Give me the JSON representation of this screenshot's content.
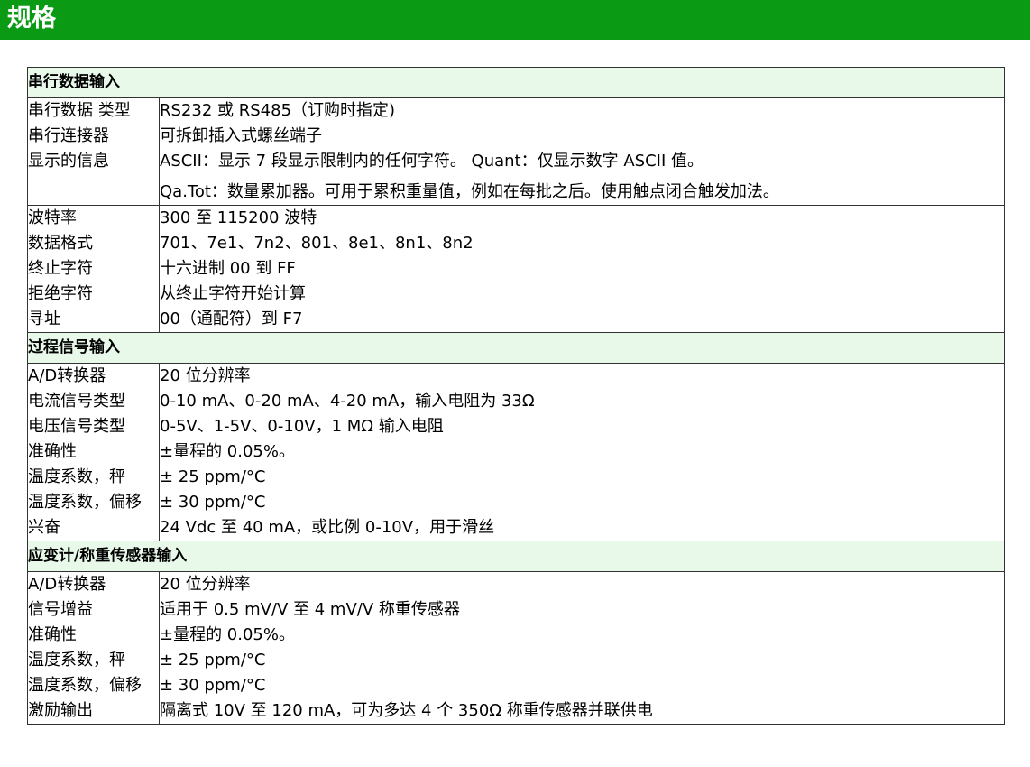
{
  "header": {
    "title": "规格"
  },
  "sections": [
    {
      "title": "串行数据输入",
      "groups": [
        {
          "labels": [
            "串行数据 类型",
            "串行连接器",
            "显示的信息"
          ],
          "values": [
            "RS232 或 RS485（订购时指定)",
            "可拆卸插入式螺丝端子",
            "ASCII：显示 7 段显示限制内的任何字符。 Quant：仅显示数字 ASCII 值。",
            "Qa.Tot：数量累加器。可用于累积重量值，例如在每批之后。使用触点闭合触发加法。"
          ]
        },
        {
          "labels": [
            "波特率",
            "数据格式",
            "终止字符",
            "拒绝字符",
            "寻址"
          ],
          "values": [
            "300 至 115200 波特",
            "701、7e1、7n2、801、8e1、8n1、8n2",
            "十六进制 00 到 FF",
            "从终止字符开始计算",
            "00（通配符）到 F7"
          ]
        }
      ]
    },
    {
      "title": "过程信号输入",
      "groups": [
        {
          "labels": [
            "A/D转换器",
            "电流信号类型",
            "电压信号类型",
            "准确性",
            "温度系数，秤",
            "温度系数，偏移",
            "兴奋"
          ],
          "values": [
            "20 位分辨率",
            "0-10 mA、0-20 mA、4-20 mA，输入电阻为 33Ω",
            "0-5V、1-5V、0-10V，1 MΩ 输入电阻",
            "±量程的 0.05%。",
            "± 25 ppm/°C",
            "± 30 ppm/°C",
            "24 Vdc 至 40 mA，或比例 0-10V，用于滑丝"
          ]
        }
      ]
    },
    {
      "title": "应变计/称重传感器输入",
      "groups": [
        {
          "labels": [
            "A/D转换器",
            "信号增益",
            "准确性",
            "温度系数，秤",
            "温度系数，偏移",
            "激励输出"
          ],
          "values": [
            "20 位分辨率",
            "适用于 0.5 mV/V 至 4 mV/V 称重传感器",
            "±量程的 0.05%。",
            "± 25 ppm/°C",
            "± 30 ppm/°C",
            "隔离式 10V 至 120 mA，可为多达 4 个 350Ω 称重传感器并联供电"
          ]
        }
      ]
    }
  ]
}
